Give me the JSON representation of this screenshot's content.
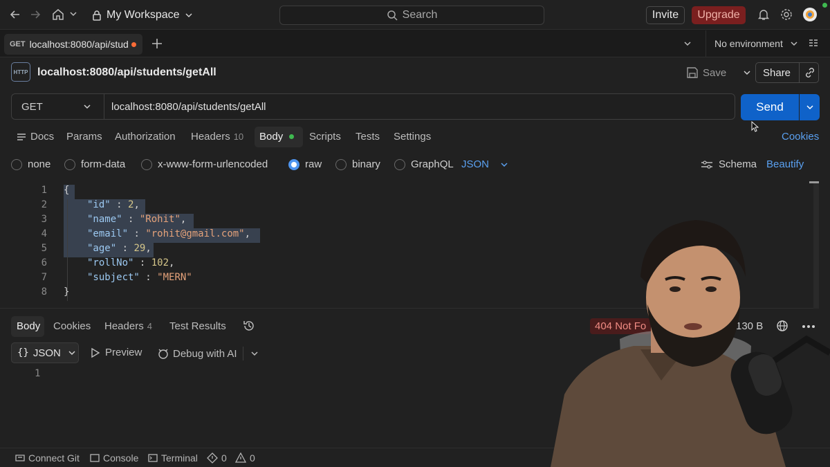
{
  "topbar": {
    "workspace": "My Workspace",
    "search_placeholder": "Search",
    "invite": "Invite",
    "upgrade": "Upgrade"
  },
  "tabbar": {
    "active_tab_method": "GET",
    "active_tab_label": "localhost:8080/api/stud",
    "environment": "No environment"
  },
  "request": {
    "title": "localhost:8080/api/students/getAll",
    "save_label": "Save",
    "share_label": "Share",
    "method": "GET",
    "url": "localhost:8080/api/students/getAll",
    "send_label": "Send"
  },
  "request_tabs": {
    "docs": "Docs",
    "params": "Params",
    "authorization": "Authorization",
    "headers": "Headers",
    "headers_count": "10",
    "body": "Body",
    "scripts": "Scripts",
    "tests": "Tests",
    "settings": "Settings",
    "cookies": "Cookies"
  },
  "body_types": {
    "none": "none",
    "form_data": "form-data",
    "urlencoded": "x-www-form-urlencoded",
    "raw": "raw",
    "binary": "binary",
    "graphql": "GraphQL",
    "format": "JSON",
    "schema": "Schema",
    "beautify": "Beautify",
    "selected": "raw"
  },
  "editor": {
    "lines": [
      "1",
      "2",
      "3",
      "4",
      "5",
      "6",
      "7",
      "8"
    ],
    "code": {
      "l1": "{",
      "l2k": "\"id\"",
      "l2v": "2",
      "l3k": "\"name\"",
      "l3v": "\"Rohit\"",
      "l4k": "\"email\"",
      "l4v": "\"rohit@gmail.com\"",
      "l5k": "\"age\"",
      "l5v": "29",
      "l6k": "\"rollNo\"",
      "l6v": "102",
      "l7k": "\"subject\"",
      "l7v": "\"MERN\"",
      "l8": "}"
    }
  },
  "response": {
    "tabs": {
      "body": "Body",
      "cookies": "Cookies",
      "headers": "Headers",
      "headers_count": "4",
      "test_results": "Test Results"
    },
    "status": "404 Not Fo",
    "size": "130 B",
    "format": "JSON",
    "preview": "Preview",
    "debug_ai": "Debug with AI",
    "line1": "1"
  },
  "bottombar": {
    "connect_git": "Connect Git",
    "console": "Console",
    "terminal": "Terminal",
    "errors": "0",
    "warnings": "0"
  },
  "colors": {
    "accent": "#0f62c9",
    "upgrade_bg": "#7a1f1f",
    "status_error": "#f08c84",
    "tab_dot": "#ff6c37",
    "body_dot": "#3fb950"
  }
}
